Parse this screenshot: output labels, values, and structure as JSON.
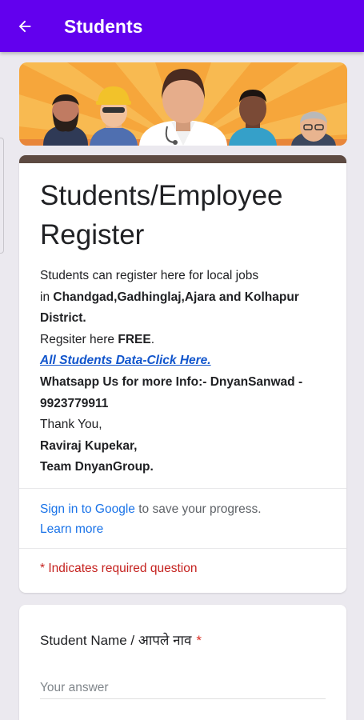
{
  "appbar": {
    "title": "Students",
    "background": "#6200ee",
    "back_icon": "arrow-left-icon"
  },
  "form": {
    "title": "Students/Employee Register",
    "description": {
      "line1": "Students can register here for local jobs",
      "line2_prefix": "in ",
      "line2_bold": "Chandgad,Gadhinglaj,Ajara and Kolhapur District.",
      "line3_prefix": "Regsiter here ",
      "line3_bold": "FREE",
      "line3_suffix": ".",
      "data_link": "All Students Data-Click Here.",
      "whatsapp": "Whatsapp Us for more Info:- DnyanSanwad - 9923779911",
      "thanks": "Thank You,",
      "name": "Raviraj Kupekar,",
      "team": "Team DnyanGroup."
    },
    "signin": {
      "link": "Sign in to Google",
      "text": " to save your progress.",
      "learn_more": "Learn more"
    },
    "required_note": "* Indicates required question",
    "accent_color": "#5d4a42"
  },
  "question": {
    "label": "Student Name / आपले नाव",
    "required_star": "*",
    "placeholder": "Your answer",
    "value": ""
  }
}
